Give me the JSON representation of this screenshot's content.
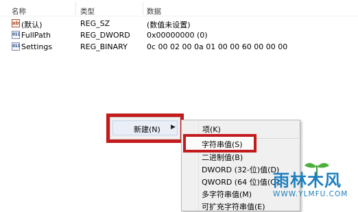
{
  "columns": {
    "name": "名称",
    "type": "类型",
    "data": "数据"
  },
  "rows": [
    {
      "icon": "string-value-icon",
      "name": "(默认)",
      "type": "REG_SZ",
      "data": "(数值未设置)"
    },
    {
      "icon": "binary-value-icon",
      "name": "FullPath",
      "type": "REG_DWORD",
      "data": "0x00000000 (0)"
    },
    {
      "icon": "binary-value-icon",
      "name": "Settings",
      "type": "REG_BINARY",
      "data": "0c 00 02 00 0a 01 00 00 60 00 00 00"
    }
  ],
  "context_menu": {
    "new_label": "新建(N)"
  },
  "submenu": {
    "items": [
      "项(K)",
      "字符串值(S)",
      "二进制值(B)",
      "DWORD (32-位)值(D)",
      "QWORD (64 位)值(Q)",
      "多字符串值(M)",
      "可扩充字符串值(E)"
    ],
    "highlighted_index": 1
  },
  "watermark": {
    "text": "雨林木风",
    "url": "WWW.YLMFU.COM"
  },
  "colors": {
    "highlight_frame": "#c21a1d",
    "watermark": "#1d7fbf"
  }
}
